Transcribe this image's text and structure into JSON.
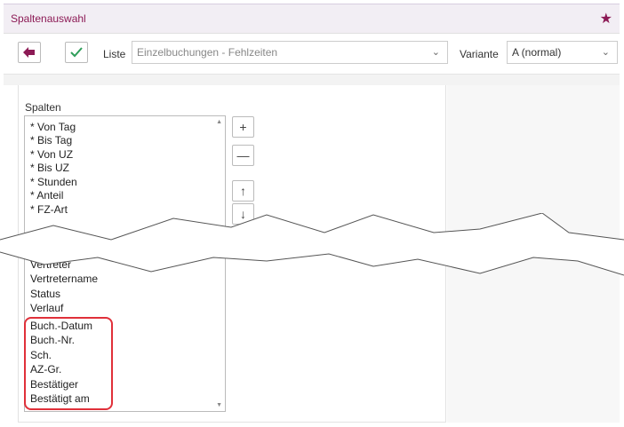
{
  "window": {
    "title": "Spaltenauswahl"
  },
  "toolbar": {
    "liste_label": "Liste",
    "liste_value": "Einzelbuchungen - Fehlzeiten",
    "variante_label": "Variante",
    "variante_value": "A (normal)"
  },
  "columns": {
    "label": "Spalten",
    "items_top": [
      "* Von Tag",
      "* Bis Tag",
      "* Von UZ",
      "* Bis UZ",
      "* Stunden",
      "* Anteil",
      "* FZ-Art"
    ],
    "items_bottom": [
      "Vertreter",
      "Vertretername",
      "Status",
      "Verlauf",
      "Buch.-Datum",
      "Buch.-Nr.",
      "Sch.",
      "AZ-Gr.",
      "Bestätiger",
      "Bestätigt am"
    ]
  },
  "colors": {
    "accent": "#8c1a55",
    "ok": "#2e9e5a",
    "highlight": "#e0303a"
  }
}
